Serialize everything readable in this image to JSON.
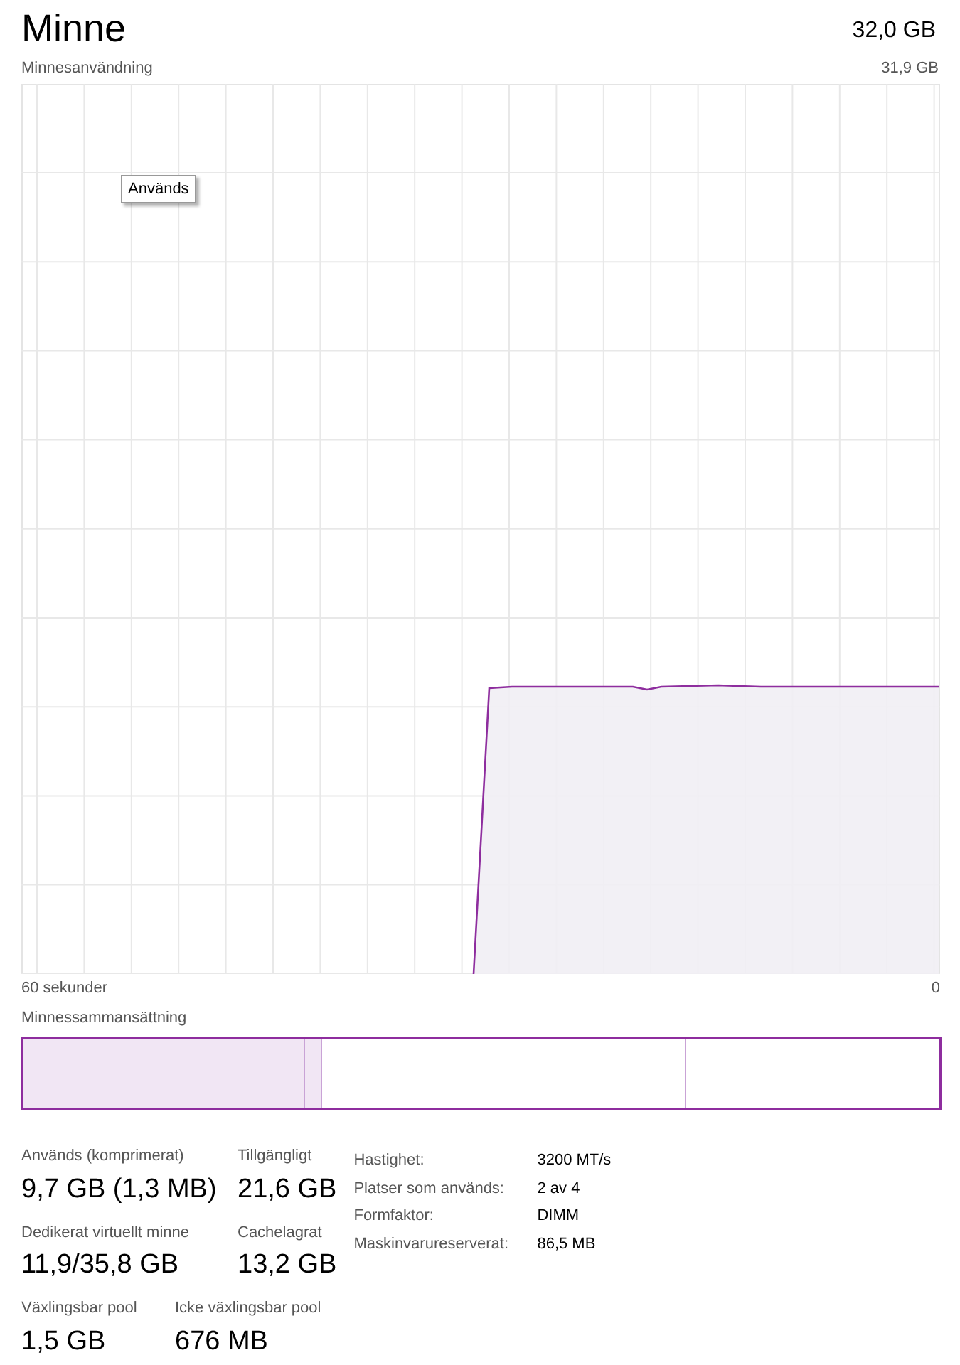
{
  "header": {
    "title": "Minne",
    "total": "32,0 GB"
  },
  "usage_chart": {
    "label": "Minnesanvändning",
    "max": "31,9 GB",
    "tooltip": "Används",
    "x_start": "60 sekunder",
    "x_end": "0"
  },
  "composition": {
    "label": "Minnessammansättning"
  },
  "stats": [
    [
      {
        "label": "Används (komprimerat)",
        "value": "9,7 GB (1,3 MB)"
      },
      {
        "label": "Tillgängligt",
        "value": "21,6 GB"
      }
    ],
    [
      {
        "label": "Dedikerat virtuellt minne",
        "value": "11,9/35,8 GB"
      },
      {
        "label": "Cachelagrat",
        "value": "13,2 GB"
      }
    ],
    [
      {
        "label": "Växlingsbar pool",
        "value": "1,5 GB"
      },
      {
        "label": "Icke växlingsbar pool",
        "value": "676 MB"
      }
    ]
  ],
  "properties": [
    {
      "label": "Hastighet:",
      "value": "3200 MT/s"
    },
    {
      "label": "Platser som används:",
      "value": "2 av 4"
    },
    {
      "label": "Formfaktor:",
      "value": "DIMM"
    },
    {
      "label": "Maskinvarureserverat:",
      "value": "86,5 MB"
    }
  ]
}
